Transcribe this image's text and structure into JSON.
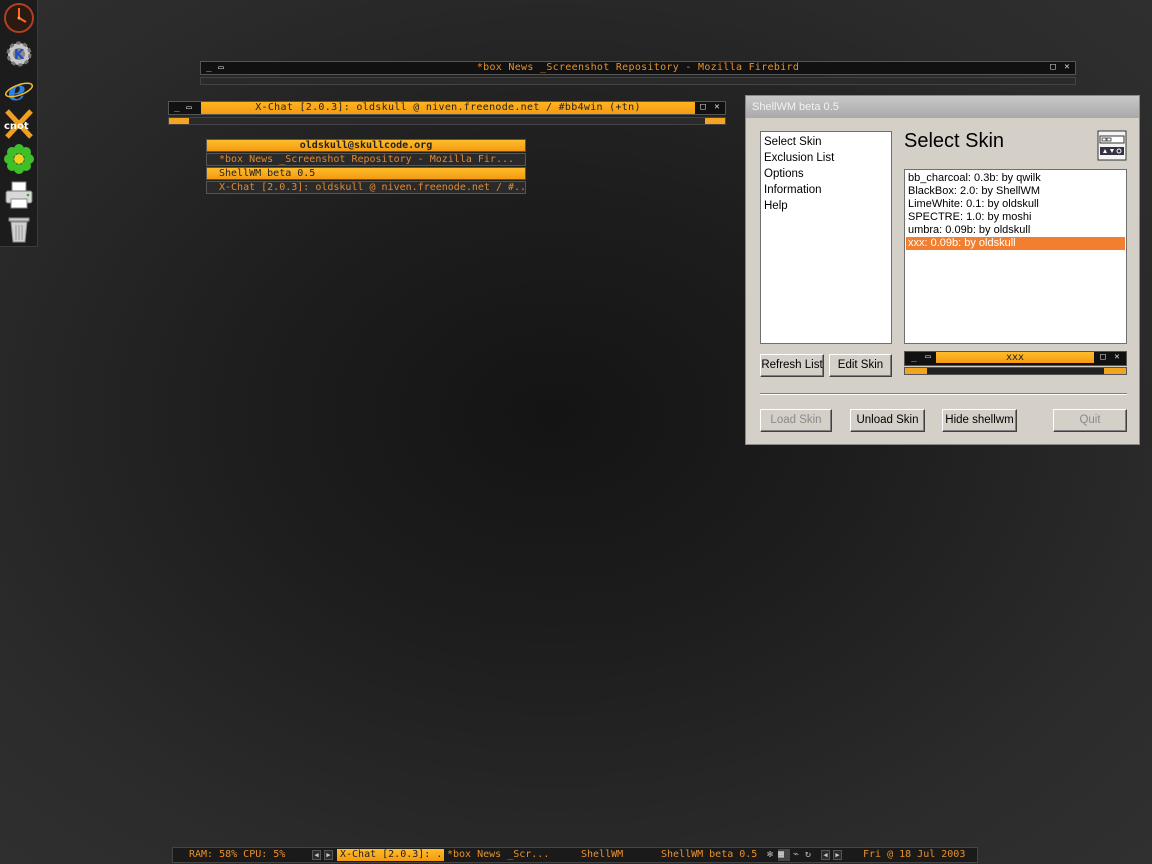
{
  "dock": {
    "icons": [
      "clock-icon",
      "kde-gear-icon",
      "internet-explorer-icon",
      "cnot-icon",
      "icq-flower-icon",
      "printer-icon",
      "trash-icon"
    ],
    "cnot_label": "cnot"
  },
  "firebird_window": {
    "title": "*box News _Screenshot Repository - Mozilla Firebird"
  },
  "xchat_window": {
    "title": "X-Chat [2.0.3]: oldskull @ niven.freenode.net / #bb4win (+tn)"
  },
  "task_popup": {
    "items": [
      "oldskull@skullcode.org",
      "*box News _Screenshot Repository - Mozilla Fir...",
      "ShellWM beta 0.5",
      "X-Chat [2.0.3]: oldskull @ niven.freenode.net / #..."
    ]
  },
  "dialog": {
    "title": "ShellWM beta 0.5",
    "nav": [
      "Select Skin",
      "Exclusion List",
      "Options",
      "Information",
      "Help"
    ],
    "section_title": "Select Skin",
    "skins": [
      "bb_charcoal: 0.3b: by qwilk",
      "BlackBox: 2.0: by ShellWM",
      "LimeWhite: 0.1: by oldskull",
      "SPECTRE: 1.0: by moshi",
      "umbra: 0.09b: by oldskull",
      "xxx: 0.09b: by oldskull"
    ],
    "selected_skin_index": 5,
    "preview_title": "xxx",
    "buttons": {
      "refresh": "Refresh List",
      "edit": "Edit Skin",
      "load": "Load Skin",
      "unload": "Unload Skin",
      "hide": "Hide shellwm",
      "quit": "Quit"
    },
    "colors": {
      "selection": "#f27e30",
      "accent": "#f3a521"
    }
  },
  "taskbar": {
    "stats": "RAM: 58% CPU: 5%",
    "tasks": [
      "X-Chat [2.0.3]: ...",
      "*box News _Scr...",
      "ShellWM",
      "ShellWM beta 0.5"
    ],
    "active_task_index": 0,
    "clock": "Fri @ 18 Jul 2003"
  }
}
